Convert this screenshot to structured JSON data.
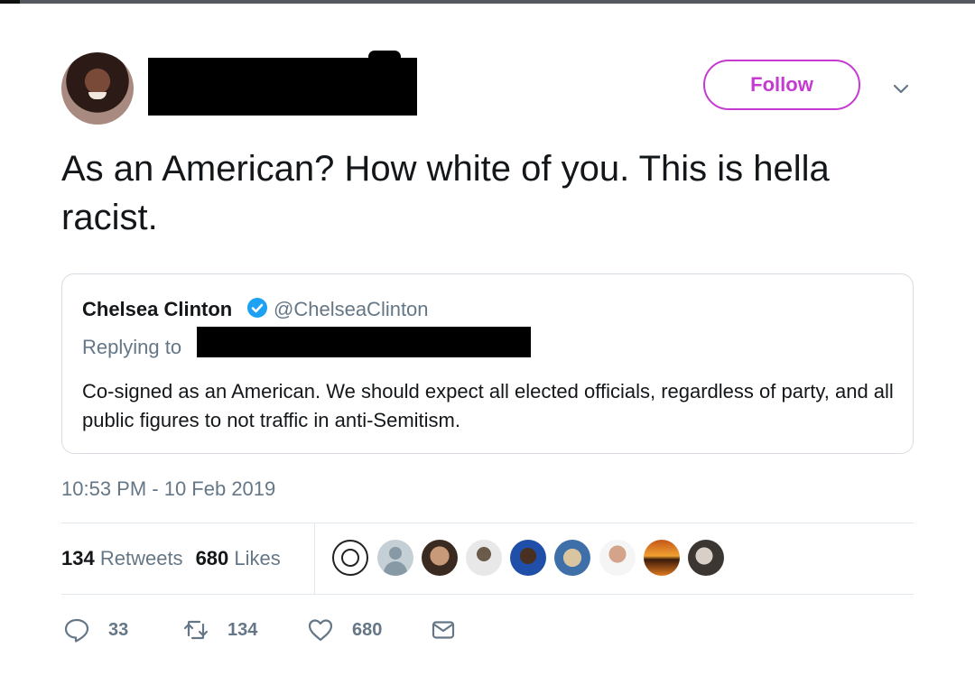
{
  "tweet": {
    "follow_label": "Follow",
    "text": "As an American? How white of you. This is hella racist.",
    "timestamp": "10:53 PM - 10 Feb 2019"
  },
  "quoted": {
    "name": "Chelsea Clinton",
    "handle": "@ChelseaClinton",
    "replying_to": "Replying to",
    "body": "Co-signed as an American. We should expect all elected officials, regardless of party, and all public figures to not traffic in anti-Semitism."
  },
  "stats": {
    "retweets_count": "134",
    "retweets_label": "Retweets",
    "likes_count": "680",
    "likes_label": "Likes"
  },
  "actions": {
    "replies": "33",
    "retweets": "134",
    "likes": "680"
  },
  "colors": {
    "accent": "#c53ad1",
    "verified": "#1da1f2",
    "muted": "#657786"
  }
}
